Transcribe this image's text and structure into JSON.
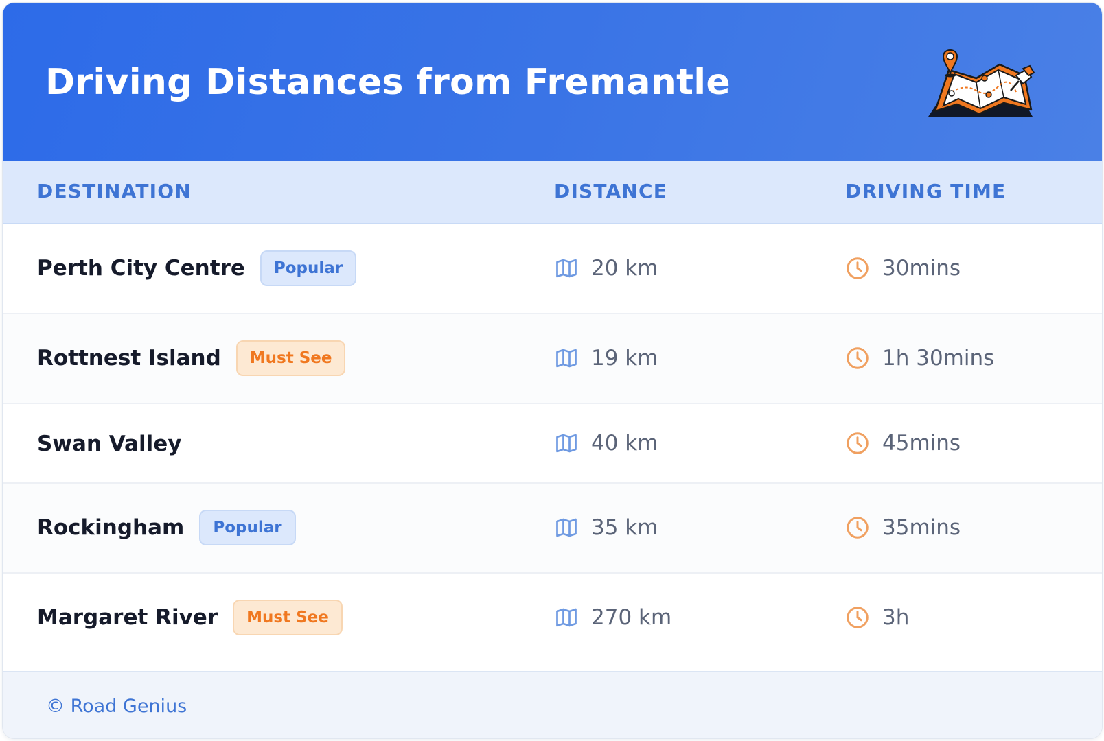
{
  "header": {
    "title": "Driving Distances from Fremantle",
    "illustration": "map-with-pins-icon",
    "gradient_start": "#2d6be8",
    "gradient_end": "#4a80e6"
  },
  "table": {
    "columns": [
      "DESTINATION",
      "DISTANCE",
      "DRIVING TIME"
    ],
    "rows": [
      {
        "destination": "Perth City Centre",
        "badge": "Popular",
        "badge_type": "popular",
        "distance": "20 km",
        "time": "30mins"
      },
      {
        "destination": "Rottnest Island",
        "badge": "Must See",
        "badge_type": "mustsee",
        "distance": "19 km",
        "time": "1h 30mins"
      },
      {
        "destination": "Swan Valley",
        "badge": "",
        "badge_type": "",
        "distance": "40 km",
        "time": "45mins"
      },
      {
        "destination": "Rockingham",
        "badge": "Popular",
        "badge_type": "popular",
        "distance": "35 km",
        "time": "35mins"
      },
      {
        "destination": "Margaret River",
        "badge": "Must See",
        "badge_type": "mustsee",
        "distance": "270 km",
        "time": "3h"
      }
    ]
  },
  "icons": {
    "distance": "map-icon",
    "time": "clock-icon"
  },
  "colors": {
    "accent_blue": "#3e74d4",
    "accent_orange": "#f07820"
  },
  "footer": {
    "text": "© Road Genius"
  }
}
